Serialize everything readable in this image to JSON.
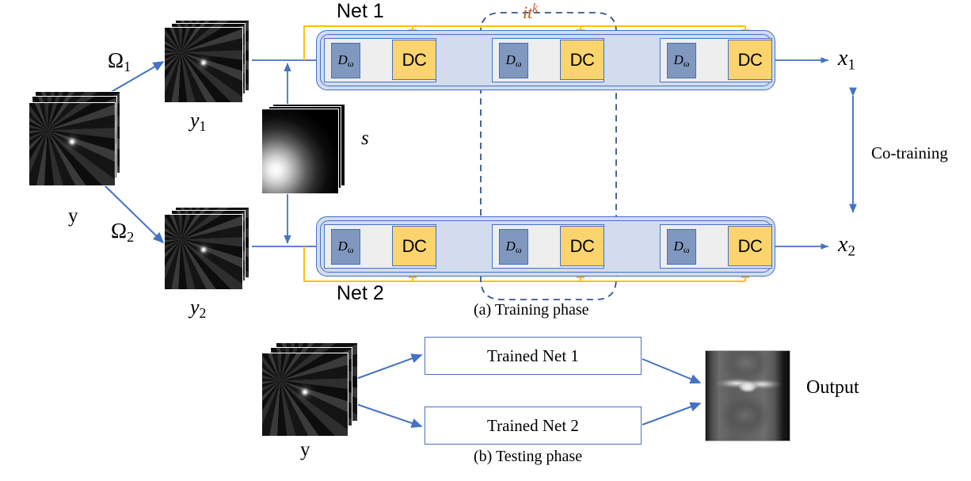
{
  "figure": {
    "caption_a": "(a) Training phase",
    "caption_b": "(b) Testing phase",
    "colors": {
      "arrow_blue": "#4472c4",
      "feedback_yellow": "#ffc000",
      "block_dc_fill": "#fbd46d",
      "block_d_fill": "#8098bf",
      "net_wrapper_fill": "#d3dcec",
      "cell_fill": "#eeeeee",
      "iteration_label": "#c55a11",
      "text": "#000000"
    }
  },
  "training": {
    "input": {
      "label": "y",
      "icon": "kspace-stack-icon"
    },
    "masks": [
      {
        "label": "Ω1",
        "base": "Ω",
        "sub": "1"
      },
      {
        "label": "Ω2",
        "base": "Ω",
        "sub": "2"
      }
    ],
    "undersampled": [
      {
        "base": "y",
        "sub": "1",
        "icon": "kspace-stack-icon"
      },
      {
        "base": "y",
        "sub": "2",
        "icon": "kspace-stack-icon"
      }
    ],
    "sensitivity": {
      "label": "s",
      "icon": "sensitivity-map-stack-icon"
    },
    "nets": [
      {
        "name": "Net 1",
        "output": {
          "base": "x",
          "sub": "1"
        },
        "stages": [
          {
            "denoiser": "Dω",
            "denoiser_base": "D",
            "denoiser_sub": "ω",
            "dc": "DC"
          },
          {
            "denoiser": "Dω",
            "denoiser_base": "D",
            "denoiser_sub": "ω",
            "dc": "DC"
          },
          {
            "denoiser": "Dω",
            "denoiser_base": "D",
            "denoiser_sub": "ω",
            "dc": "DC"
          }
        ]
      },
      {
        "name": "Net 2",
        "output": {
          "base": "x",
          "sub": "2"
        },
        "stages": [
          {
            "denoiser": "Dω",
            "denoiser_base": "D",
            "denoiser_sub": "ω",
            "dc": "DC"
          },
          {
            "denoiser": "Dω",
            "denoiser_base": "D",
            "denoiser_sub": "ω",
            "dc": "DC"
          },
          {
            "denoiser": "Dω",
            "denoiser_base": "D",
            "denoiser_sub": "ω",
            "dc": "DC"
          }
        ]
      }
    ],
    "iteration": {
      "base": "it",
      "sup": "k",
      "label": "it k"
    },
    "co_training": {
      "label": "Co-training"
    }
  },
  "testing": {
    "input": {
      "label": "y",
      "icon": "kspace-stack-icon"
    },
    "boxes": [
      {
        "label": "Trained Net 1"
      },
      {
        "label": "Trained Net 2"
      }
    ],
    "output": {
      "label": "Output",
      "icon": "knee-mri-icon"
    }
  }
}
